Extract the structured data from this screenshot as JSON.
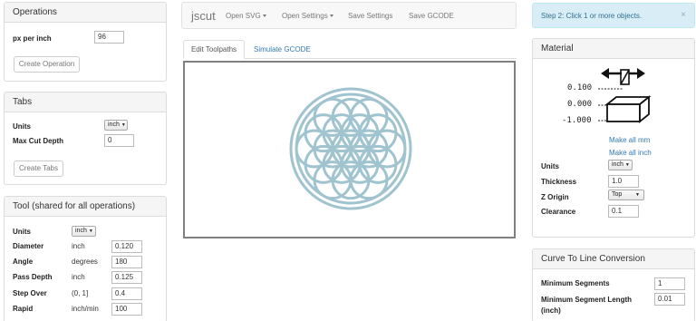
{
  "operations": {
    "title": "Operations",
    "px_per_inch_label": "px per inch",
    "px_per_inch_value": "96",
    "create_button": "Create Operation"
  },
  "tabs_panel": {
    "title": "Tabs",
    "units_label": "Units",
    "units_value": "inch",
    "max_cut_depth_label": "Max Cut Depth",
    "max_cut_depth_value": "0",
    "create_button": "Create Tabs"
  },
  "tool": {
    "title": "Tool (shared for all operations)",
    "units_label": "Units",
    "units_value": "inch",
    "rows": [
      {
        "label": "Diameter",
        "unit": "inch",
        "value": "0.120"
      },
      {
        "label": "Angle",
        "unit": "degrees",
        "value": "180"
      },
      {
        "label": "Pass Depth",
        "unit": "inch",
        "value": "0.125"
      },
      {
        "label": "Step Over",
        "unit": "(0, 1]",
        "value": "0.4"
      },
      {
        "label": "Rapid",
        "unit": "inch/min",
        "value": "100"
      }
    ]
  },
  "navbar": {
    "brand": "jscut",
    "open_svg": "Open SVG",
    "open_settings": "Open Settings",
    "save_settings": "Save Settings",
    "save_gcode": "Save GCODE"
  },
  "main_tabs": {
    "edit_toolpaths": "Edit Toolpaths",
    "simulate_gcode": "Simulate GCODE"
  },
  "alert": {
    "text": "Step 2: Click 1 or more objects.",
    "close": "×"
  },
  "material": {
    "title": "Material",
    "diagram_values": [
      "0.100",
      "0.000",
      "-1.000"
    ],
    "make_all_mm": "Make all mm",
    "make_all_inch": "Make all inch",
    "units_label": "Units",
    "units_value": "inch",
    "thickness_label": "Thickness",
    "thickness_value": "1.0",
    "z_origin_label": "Z Origin",
    "z_origin_value": "Top",
    "clearance_label": "Clearance",
    "clearance_value": "0.1"
  },
  "curve": {
    "title": "Curve To Line Conversion",
    "min_segments_label": "Minimum Segments",
    "min_segments_value": "1",
    "min_segment_length_label": "Minimum Segment Length (inch)",
    "min_segment_length_value": "0.01"
  },
  "colors": {
    "artwork": "#9fc3cf",
    "link": "#337ab7",
    "alert_bg": "#d9edf7"
  }
}
